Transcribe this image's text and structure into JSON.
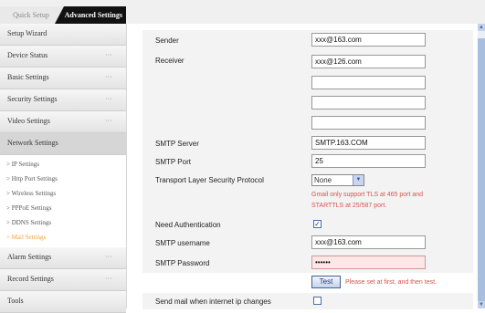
{
  "tabs": {
    "quick_setup": "Quick Setup",
    "advanced_settings": "Advanced Settings"
  },
  "sidebar": {
    "items": [
      {
        "label": "Setup Wizard",
        "dots": ""
      },
      {
        "label": "Device Status",
        "dots": "···"
      },
      {
        "label": "Basic Settings",
        "dots": "···"
      },
      {
        "label": "Security Settings",
        "dots": "···"
      },
      {
        "label": "Video Settings",
        "dots": "···"
      },
      {
        "label": "Network Settings",
        "dots": ""
      },
      {
        "label": "Alarm Settings",
        "dots": "···"
      },
      {
        "label": "Record Settings",
        "dots": "···"
      },
      {
        "label": "Tools",
        "dots": "···"
      }
    ],
    "network_subitems": [
      "> IP Settings",
      "> Http Port Settings",
      "> Wireless Settings",
      "> PPPoE Settings",
      "> DDNS Settings",
      "> Mail Settings"
    ]
  },
  "form": {
    "sender_label": "Sender",
    "sender_value": "xxx@163.com",
    "receiver_label": "Receiver",
    "receiver_values": [
      "xxx@126.com",
      "",
      "",
      ""
    ],
    "smtp_server_label": "SMTP Server",
    "smtp_server_value": "SMTP.163.COM",
    "smtp_port_label": "SMTP Port",
    "smtp_port_value": "25",
    "tls_label": "Transport Layer Security Protocol",
    "tls_value": "None",
    "tls_hint_line1": "Gmail only support TLS at 465 port and",
    "tls_hint_line2": "STARTTLS at 25/587 port.",
    "need_auth_label": "Need Authentication",
    "need_auth_checked": true,
    "smtp_username_label": "SMTP username",
    "smtp_username_value": "xxx@163.com",
    "smtp_password_label": "SMTP Password",
    "smtp_password_value": "••••••",
    "test_button": "Test",
    "test_hint": "Please set at first, and then test.",
    "send_on_ip_change_label": "Send mail when internet ip changes",
    "send_on_ip_change_checked": false
  },
  "colors": {
    "accent_orange": "#f2a23a",
    "hint_red": "#d9534f",
    "tab_active_bg": "#111111"
  }
}
